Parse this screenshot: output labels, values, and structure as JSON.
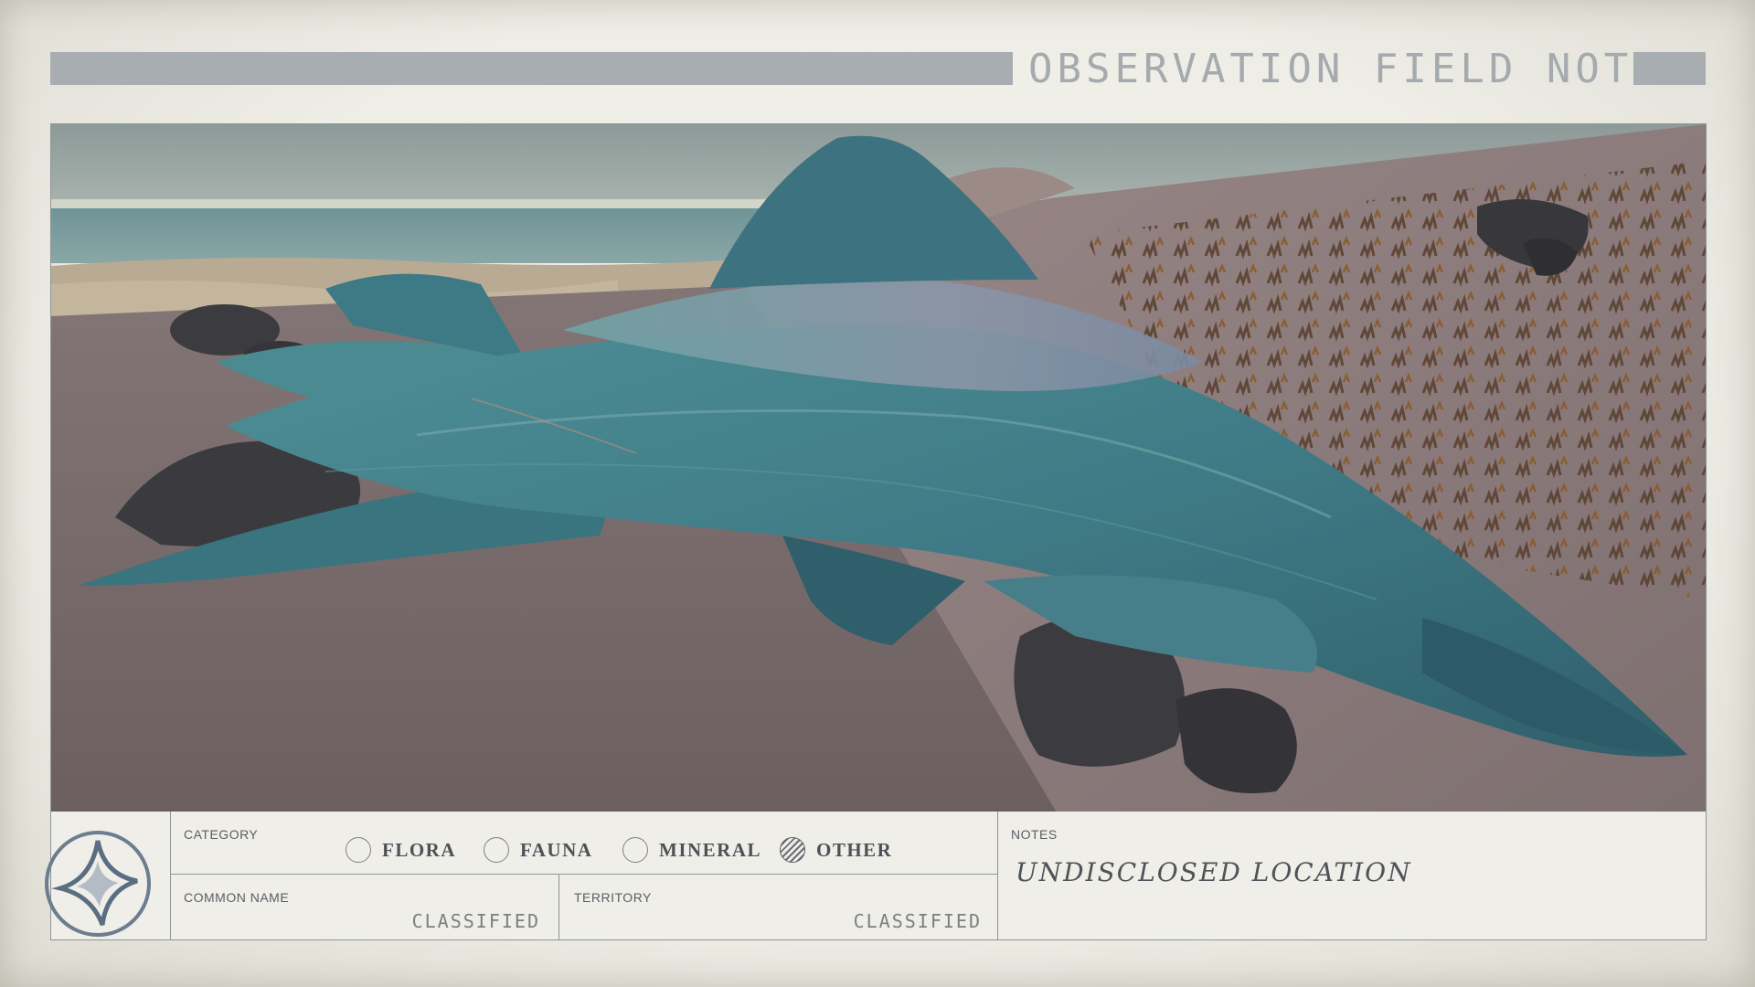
{
  "header": {
    "title": "OBSERVATION FIELD NOTES"
  },
  "photo": {
    "subject": "creature-photo"
  },
  "panel": {
    "category_label": "CATEGORY",
    "categories": [
      {
        "label": "FLORA",
        "selected": false
      },
      {
        "label": "FAUNA",
        "selected": false
      },
      {
        "label": "MINERAL",
        "selected": false
      },
      {
        "label": "OTHER",
        "selected": true
      }
    ],
    "common_name_label": "COMMON NAME",
    "common_name_value": "CLASSIFIED",
    "territory_label": "TERRITORY",
    "territory_value": "CLASSIFIED",
    "notes_label": "NOTES",
    "notes_value": "UNDISCLOSED LOCATION"
  },
  "colors": {
    "paper": "#efeee8",
    "bar": "#a7adb1",
    "creature": "#3f7b86",
    "sand": "#7a6c6c",
    "sky": "#8f9e9c"
  },
  "icons": {
    "logo": "star-emblem-icon"
  }
}
